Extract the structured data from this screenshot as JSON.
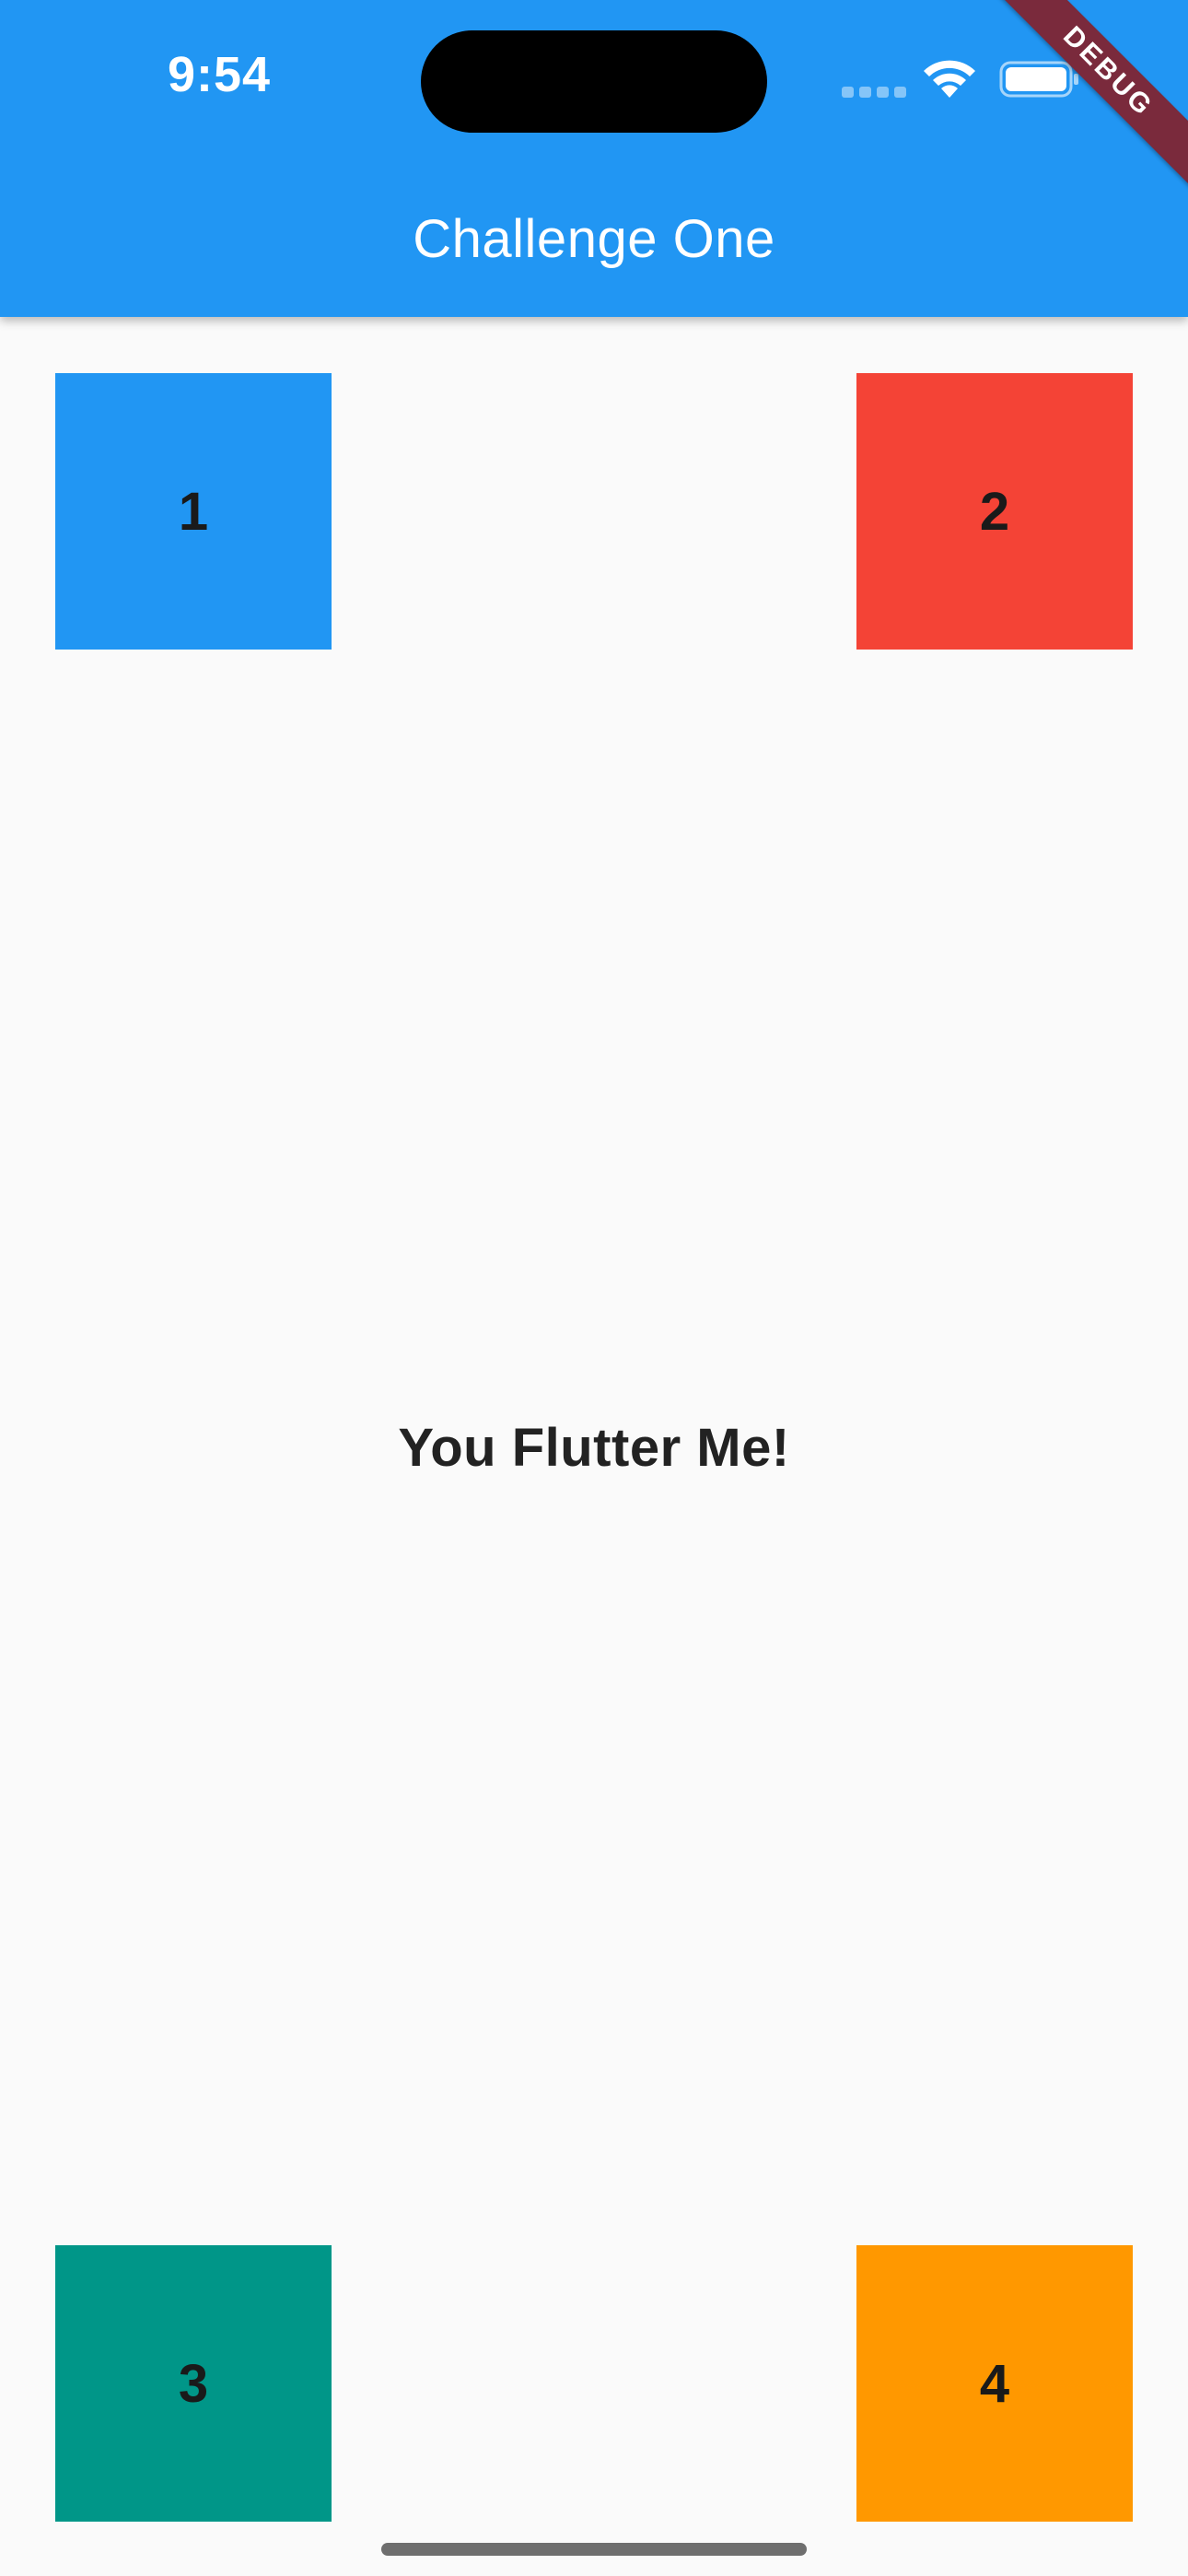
{
  "status_bar": {
    "time": "9:54"
  },
  "app_bar": {
    "title": "Challenge One",
    "color": "#2196f3"
  },
  "debug_banner": {
    "label": "DEBUG",
    "color": "#7a2a3c"
  },
  "boxes": [
    {
      "label": "1",
      "color": "#2196f3"
    },
    {
      "label": "2",
      "color": "#f44336"
    },
    {
      "label": "3",
      "color": "#009688"
    },
    {
      "label": "4",
      "color": "#ff9800"
    }
  ],
  "center_message": "You Flutter Me!",
  "icons": {
    "signal": "cellular-signal-icon",
    "wifi": "wifi-icon",
    "battery": "battery-icon"
  }
}
